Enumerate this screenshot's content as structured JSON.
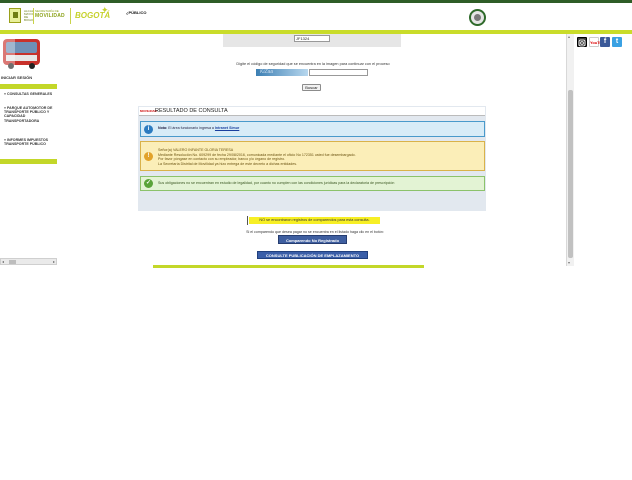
{
  "header": {
    "alcaldia_text": "ALCALDÍA MAYOR DE BOGOTÁ D.C.",
    "secretaria_text": "SECRETARÍA DE",
    "movilidad_text": "MOVILIDAD",
    "bogota_text": "BOGOTÁ",
    "header_link": "¿PÚBLICO"
  },
  "sidebar": {
    "login_label": "INICIAR SESIÓN",
    "items": [
      {
        "label": "» CONSULTAS GENERALES"
      },
      {
        "label": "» PARQUE AUTOMOTOR DE TRANSPORTE PÚBLICO Y CAPACIDAD TRANSPORTADORA"
      },
      {
        "label": "» INFORMES IMPUESTOS TRANSPORTE PÚBLICO"
      }
    ]
  },
  "captcha": {
    "code_value": "JF1324",
    "instruction": "Digite el código de seguridad que se encuentra en la imagen para continuar con el proceso",
    "image_text": "KiZaa",
    "button_label": "Buscar"
  },
  "result": {
    "logo_text": "MOVILIDAD",
    "title": "RESULTADO DE CONSULTA",
    "info_note_prefix": "Nota:",
    "info_note_text": "El área funcionario ingresa a",
    "info_note_link": "Intranet Simur",
    "warning_lines": [
      "Señor(a) VALERO INFANTE GLORIA TERESA",
      "Mediante Resolución No. 609299 de fecha 29/08/2016, comunicada mediante el oficio No 172351 usted fue desembargado.",
      "Por favor póngase en contacto con su empleador, banco y/o órgano de registro.",
      "La Secretaría Distrital de Movilidad ya hizo entrega de este decreto a dichas entidades."
    ],
    "ok_text": "Sus obligaciones no se encuentran en estudio de legalidad, por cuanto no cumplen con las condiciones jurídicas para la declaratoria de prescripción"
  },
  "actions": {
    "no_record_text": "NO se encontraron registros de comparendos para esta consulta.",
    "compare_text": "Si el comparendo que desea pagar no se encuentra en el listado haga clic en el botón:",
    "compare_button": "Comparendo No Registrado",
    "publish_button": "CONSULTE PUBLICACIÓN DE EMPLAZAMIENTO"
  },
  "social": {
    "instagram": "instagram-icon",
    "youtube": "YouTube",
    "facebook": "f",
    "twitter": "t"
  },
  "colors": {
    "brand_green": "#c3d729",
    "dark_green": "#2f5d27",
    "button_blue": "#3a5ea8"
  }
}
